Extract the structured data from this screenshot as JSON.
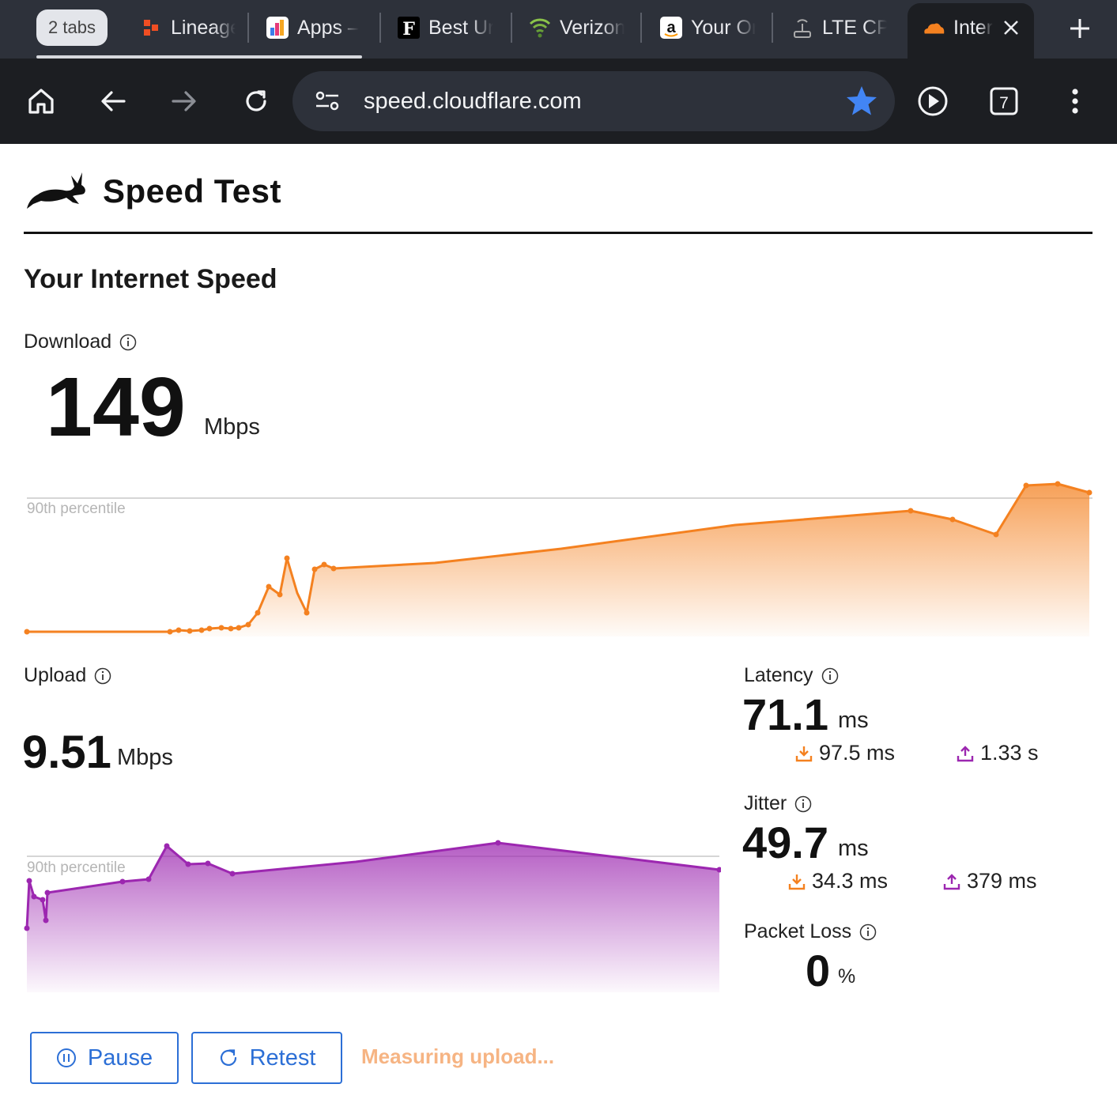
{
  "browser": {
    "tab_group_label": "2 tabs",
    "tabs": [
      {
        "label": "Lineage",
        "icon": "lineage-icon"
      },
      {
        "label": "Apps –",
        "icon": "apps-icon"
      },
      {
        "label": "Best Ur",
        "icon": "forbes-icon"
      },
      {
        "label": "Verizon",
        "icon": "wifi-icon"
      },
      {
        "label": "Your Or",
        "icon": "amazon-icon"
      },
      {
        "label": "LTE CP",
        "icon": "router-icon"
      },
      {
        "label": "Inter",
        "icon": "cloudflare-icon",
        "active": true
      }
    ],
    "tab_count": "7",
    "url": "speed.cloudflare.com",
    "colors": {
      "star": "#4285f4",
      "strip": "#2d313a",
      "toolbar": "#1c1e22"
    }
  },
  "page": {
    "brand_title": "Speed Test",
    "section_title": "Your Internet Speed",
    "download": {
      "label": "Download",
      "value": "149",
      "unit": "Mbps",
      "percentile_label": "90th percentile",
      "color": "#f48120"
    },
    "upload": {
      "label": "Upload",
      "value": "9.51",
      "unit": "Mbps",
      "percentile_label": "90th percentile",
      "color": "#9c27b0"
    },
    "latency": {
      "label": "Latency",
      "value": "71.1",
      "unit": "ms",
      "down": "97.5 ms",
      "up": "1.33 s"
    },
    "jitter": {
      "label": "Jitter",
      "value": "49.7",
      "unit": "ms",
      "down": "34.3 ms",
      "up": "379 ms"
    },
    "packet_loss": {
      "label": "Packet Loss",
      "value": "0",
      "unit": "%"
    },
    "buttons": {
      "pause": "Pause",
      "retest": "Retest"
    },
    "status": "Measuring upload..."
  }
}
